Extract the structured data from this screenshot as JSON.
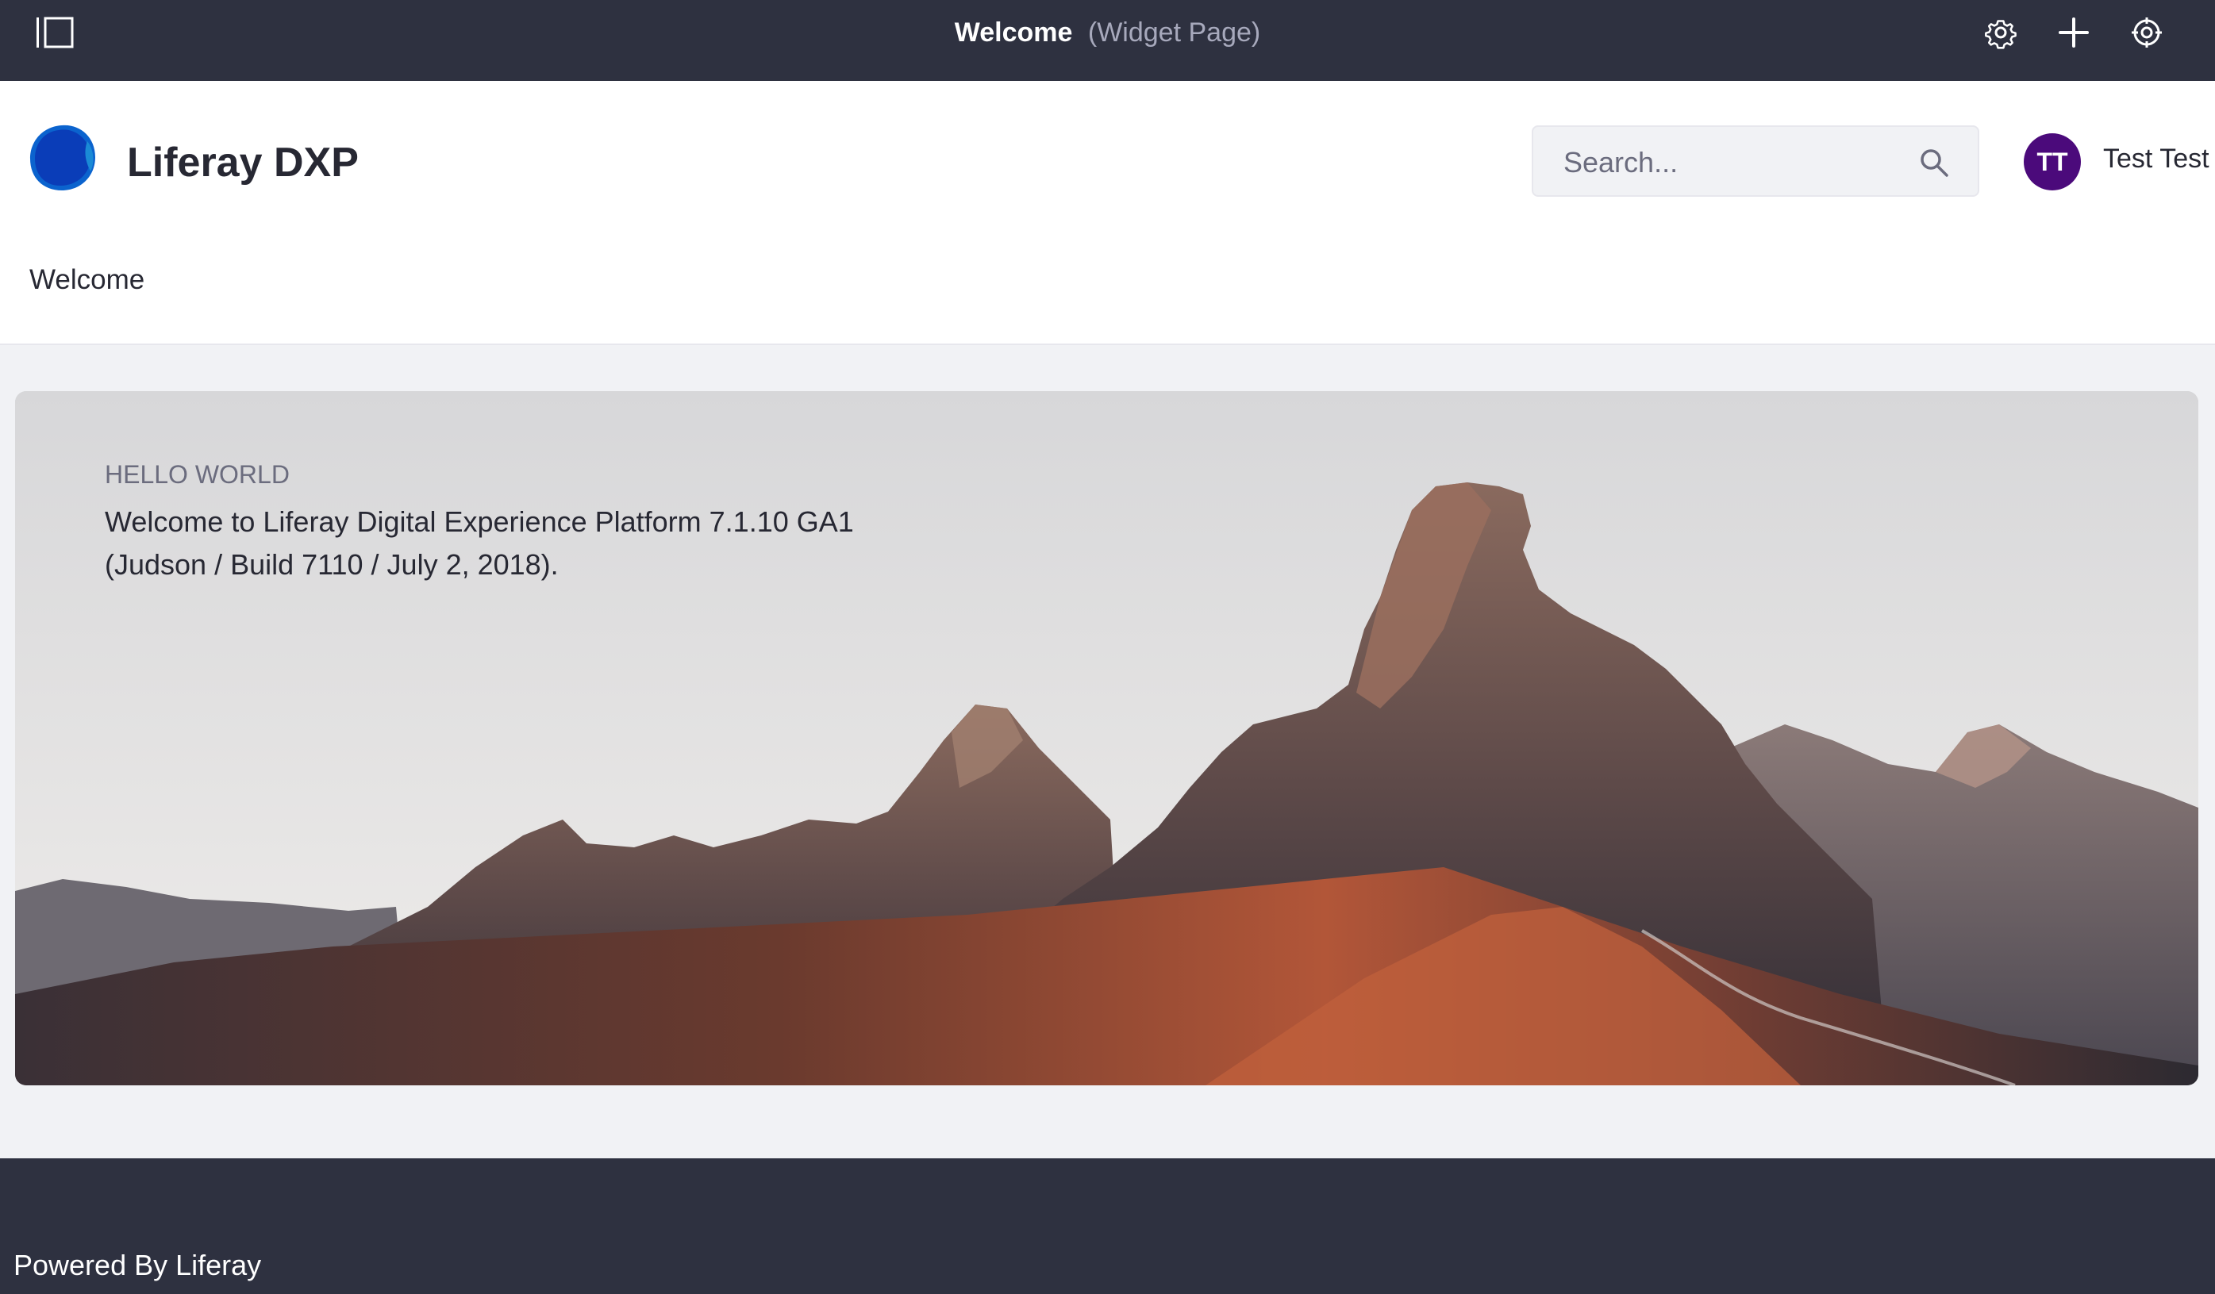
{
  "control_menu": {
    "page_name": "Welcome",
    "page_type": "(Widget Page)",
    "icons": [
      "product-menu-toggle-icon",
      "gear-icon",
      "plus-icon",
      "simulation-icon"
    ]
  },
  "header": {
    "site_name": "Liferay DXP",
    "search": {
      "placeholder": "Search...",
      "value": ""
    },
    "user": {
      "initials": "TT",
      "name": "Test Test"
    },
    "nav": {
      "items": [
        {
          "label": "Welcome"
        }
      ]
    }
  },
  "banner": {
    "kicker": "HELLO WORLD",
    "line1": "Welcome to Liferay Digital Experience Platform 7.1.10 GA1",
    "line2": "(Judson / Build 7110 / July 2, 2018)."
  },
  "footer": {
    "powered_by": "Powered By Liferay"
  },
  "colors": {
    "control_menu_bg": "#2e3140",
    "avatar_bg": "#4b0a7b",
    "logo_primary": "#0b5fff",
    "page_bg": "#f1f2f5"
  }
}
